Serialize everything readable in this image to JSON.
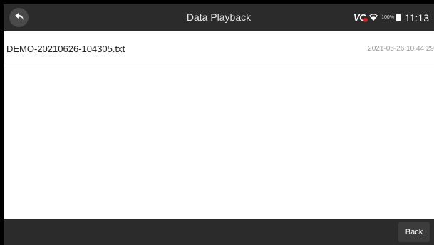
{
  "header": {
    "title": "Data Playback",
    "vci_label": "VC",
    "battery_level": "100%",
    "time": "11:13",
    "back_icon": "back-arrow-icon",
    "wifi_icon": "wifi-icon",
    "battery_icon": "battery-icon"
  },
  "files": [
    {
      "name": "DEMO-20210626-104305.txt",
      "date": "2021-06-26 10:44:29"
    }
  ],
  "footer": {
    "back_label": "Back"
  },
  "colors": {
    "bar_background": "#2b2b2b",
    "content_background": "#ffffff",
    "vci_indicator": "#e02020"
  }
}
